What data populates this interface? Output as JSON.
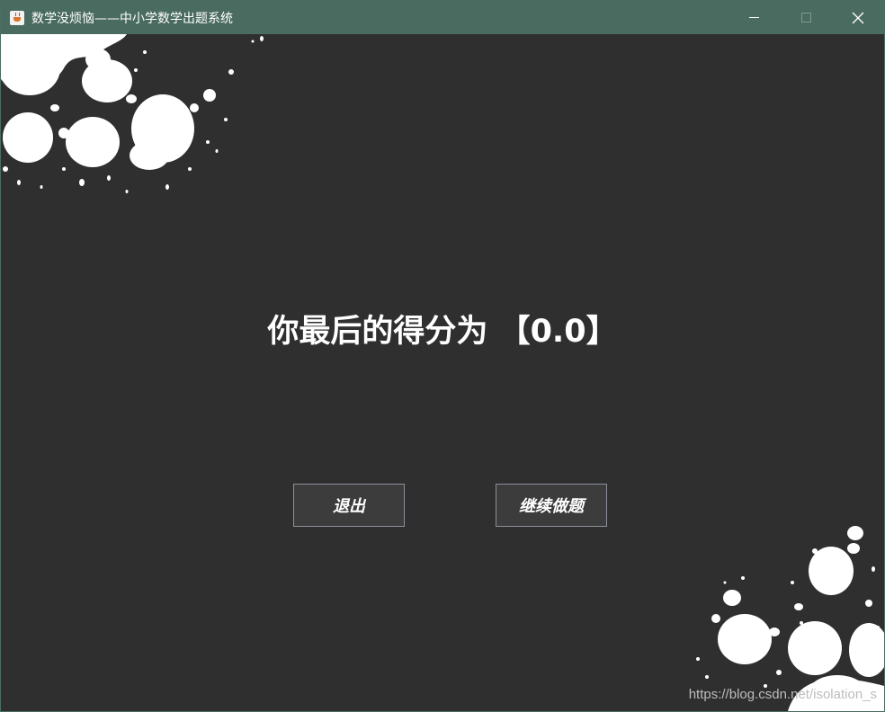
{
  "window": {
    "title": "数学没烦恼——中小学数学出题系统",
    "accent_color": "#4a6b60",
    "background_color": "#2f2f2f"
  },
  "result": {
    "score_text": "你最后的得分为 【0.0】"
  },
  "buttons": {
    "exit_label": "退出",
    "continue_label": "继续做题"
  },
  "decorations": {
    "top_left": "paint-splatter",
    "bottom_right": "paint-splatter"
  },
  "watermark": {
    "text": "https://blog.csdn.net/isolation_s"
  }
}
